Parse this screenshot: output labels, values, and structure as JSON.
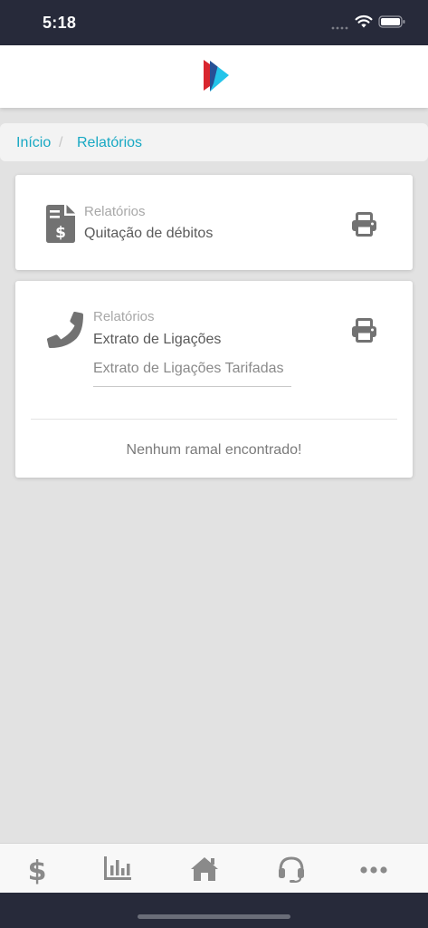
{
  "status_bar": {
    "time": "5:18"
  },
  "breadcrumb": {
    "home": "Início",
    "separator": "/",
    "current": "Relatórios"
  },
  "cards": [
    {
      "sublabel": "Relatórios",
      "title": "Quitação de débitos",
      "icon": "invoice-dollar-icon"
    },
    {
      "sublabel": "Relatórios",
      "title": "Extrato de Ligações",
      "icon": "phone-icon",
      "select_value": "Extrato de Ligações Tarifadas",
      "empty_message": "Nenhum ramal encontrado!"
    }
  ],
  "tab_bar": {
    "items": [
      {
        "icon": "dollar-icon"
      },
      {
        "icon": "bar-chart-icon"
      },
      {
        "icon": "home-icon"
      },
      {
        "icon": "headset-icon"
      },
      {
        "icon": "more-icon"
      }
    ]
  },
  "colors": {
    "accent": "#17a8c3",
    "status_bar": "#272a3a",
    "icon_gray": "#727272",
    "page_background": "#e2e2e2",
    "logo_red": "#d9262f",
    "logo_cyan": "#23c4ea"
  }
}
